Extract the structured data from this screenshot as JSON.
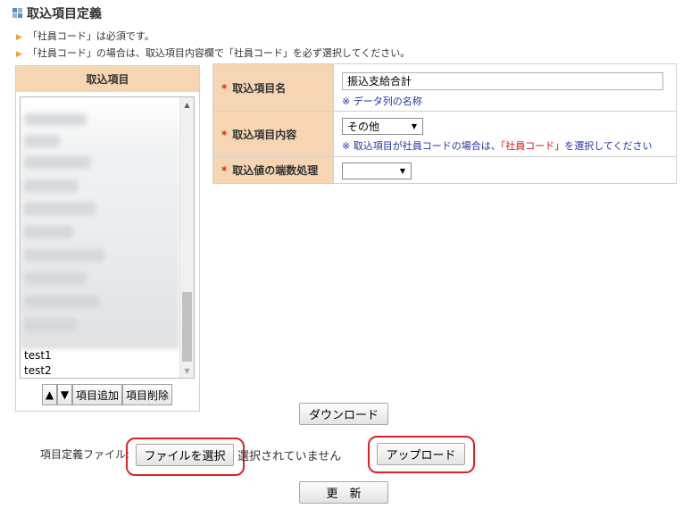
{
  "page": {
    "title": "取込項目定義"
  },
  "notes": [
    "「社員コード」は必須です。",
    "「社員コード」の場合は、取込項目内容欄で「社員コード」を必ず選択してください。"
  ],
  "item_list": {
    "header": "取込項目",
    "items": [
      "test1",
      "test2"
    ],
    "buttons": {
      "up": "▲",
      "down": "▼",
      "add": "項目追加",
      "delete": "項目削除"
    }
  },
  "form": {
    "name_label": "取込項目名",
    "name_value": "振込支給合計",
    "name_hint": "※ データ列の名称",
    "content_label": "取込項目内容",
    "content_value": "その他",
    "content_hint_prefix": "※ 取込項目が社員コードの場合は、",
    "content_hint_emph": "「社員コード」",
    "content_hint_suffix": "を選択してください",
    "rounding_label": "取込値の端数処理",
    "rounding_value": "",
    "required_mark": "*"
  },
  "actions": {
    "download": "ダウンロード",
    "file_label": "項目定義ファイル:",
    "file_button": "ファイルを選択",
    "file_status": "選択されていません",
    "upload": "アップロード",
    "update": "更　新"
  },
  "icons": {
    "title": "grid-icon",
    "note": "triangle-right-icon",
    "select": "caret-down-icon"
  },
  "colors": {
    "header_bg": "#f6d5b3",
    "required": "#e02020",
    "hint": "#2233aa",
    "highlight_ring": "#e0202a"
  }
}
